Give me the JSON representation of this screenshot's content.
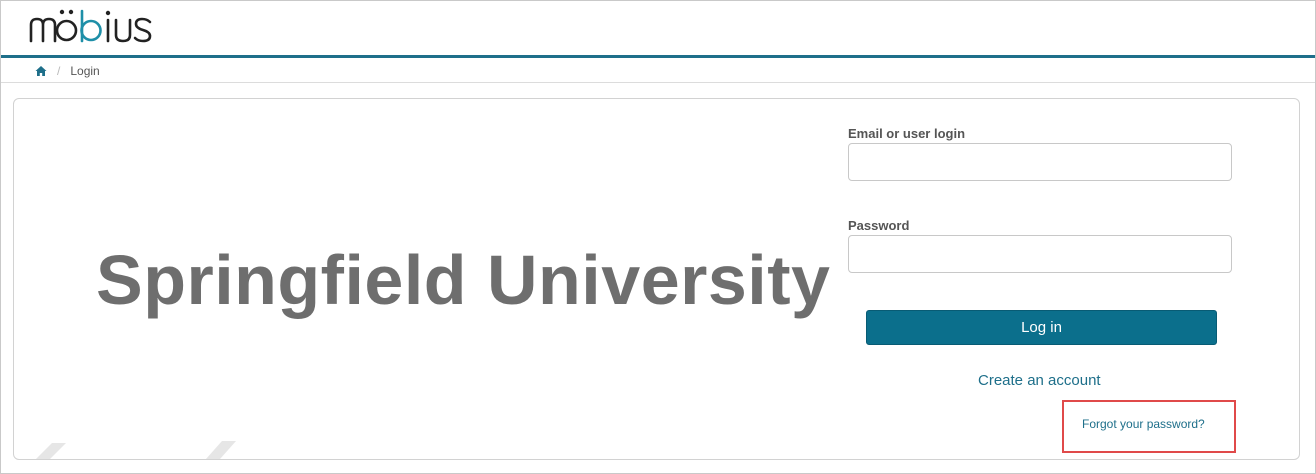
{
  "header": {
    "logo_text": "mobius",
    "accent_color": "#1e6f8a"
  },
  "breadcrumb": {
    "home_icon": "home-icon",
    "separator": "/",
    "current": "Login"
  },
  "main": {
    "brand_name": "Springfield University"
  },
  "login_form": {
    "email_label": "Email or user login",
    "email_value": "",
    "password_label": "Password",
    "password_value": "",
    "login_button": "Log in",
    "create_account": "Create an account",
    "forgot_password": "Forgot your password?",
    "button_color": "#0b6f8c",
    "highlight_color": "#e04a4a"
  }
}
